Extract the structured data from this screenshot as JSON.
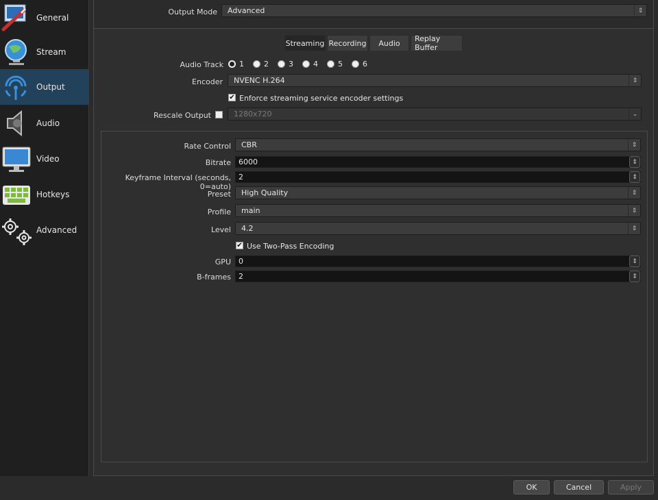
{
  "sidebar": {
    "items": [
      {
        "label": "General",
        "icon": "general-icon"
      },
      {
        "label": "Stream",
        "icon": "stream-icon"
      },
      {
        "label": "Output",
        "icon": "output-icon",
        "active": true
      },
      {
        "label": "Audio",
        "icon": "audio-icon"
      },
      {
        "label": "Video",
        "icon": "video-icon"
      },
      {
        "label": "Hotkeys",
        "icon": "hotkeys-icon"
      },
      {
        "label": "Advanced",
        "icon": "advanced-icon"
      }
    ]
  },
  "output_mode": {
    "label": "Output Mode",
    "value": "Advanced"
  },
  "tabs": [
    {
      "label": "Streaming",
      "active": true
    },
    {
      "label": "Recording"
    },
    {
      "label": "Audio"
    },
    {
      "label": "Replay Buffer"
    }
  ],
  "audio_track": {
    "label": "Audio Track",
    "options": [
      "1",
      "2",
      "3",
      "4",
      "5",
      "6"
    ],
    "selected": "1"
  },
  "encoder": {
    "label": "Encoder",
    "value": "NVENC H.264"
  },
  "enforce": {
    "label": "Enforce streaming service encoder settings",
    "checked": true
  },
  "rescale": {
    "label": "Rescale Output",
    "checked": false,
    "value": "1280x720"
  },
  "encoder_settings": {
    "rate_control": {
      "label": "Rate Control",
      "value": "CBR"
    },
    "bitrate": {
      "label": "Bitrate",
      "value": "6000"
    },
    "keyframe": {
      "label": "Keyframe Interval (seconds, 0=auto)",
      "value": "2"
    },
    "preset": {
      "label": "Preset",
      "value": "High Quality"
    },
    "profile": {
      "label": "Profile",
      "value": "main"
    },
    "level": {
      "label": "Level",
      "value": "4.2"
    },
    "two_pass": {
      "label": "Use Two-Pass Encoding",
      "checked": true
    },
    "gpu": {
      "label": "GPU",
      "value": "0"
    },
    "bframes": {
      "label": "B-frames",
      "value": "2"
    }
  },
  "footer": {
    "ok": "OK",
    "cancel": "Cancel",
    "apply": "Apply"
  },
  "colors": {
    "sidebar_active": "#22415a",
    "background": "#2b2b2b"
  }
}
